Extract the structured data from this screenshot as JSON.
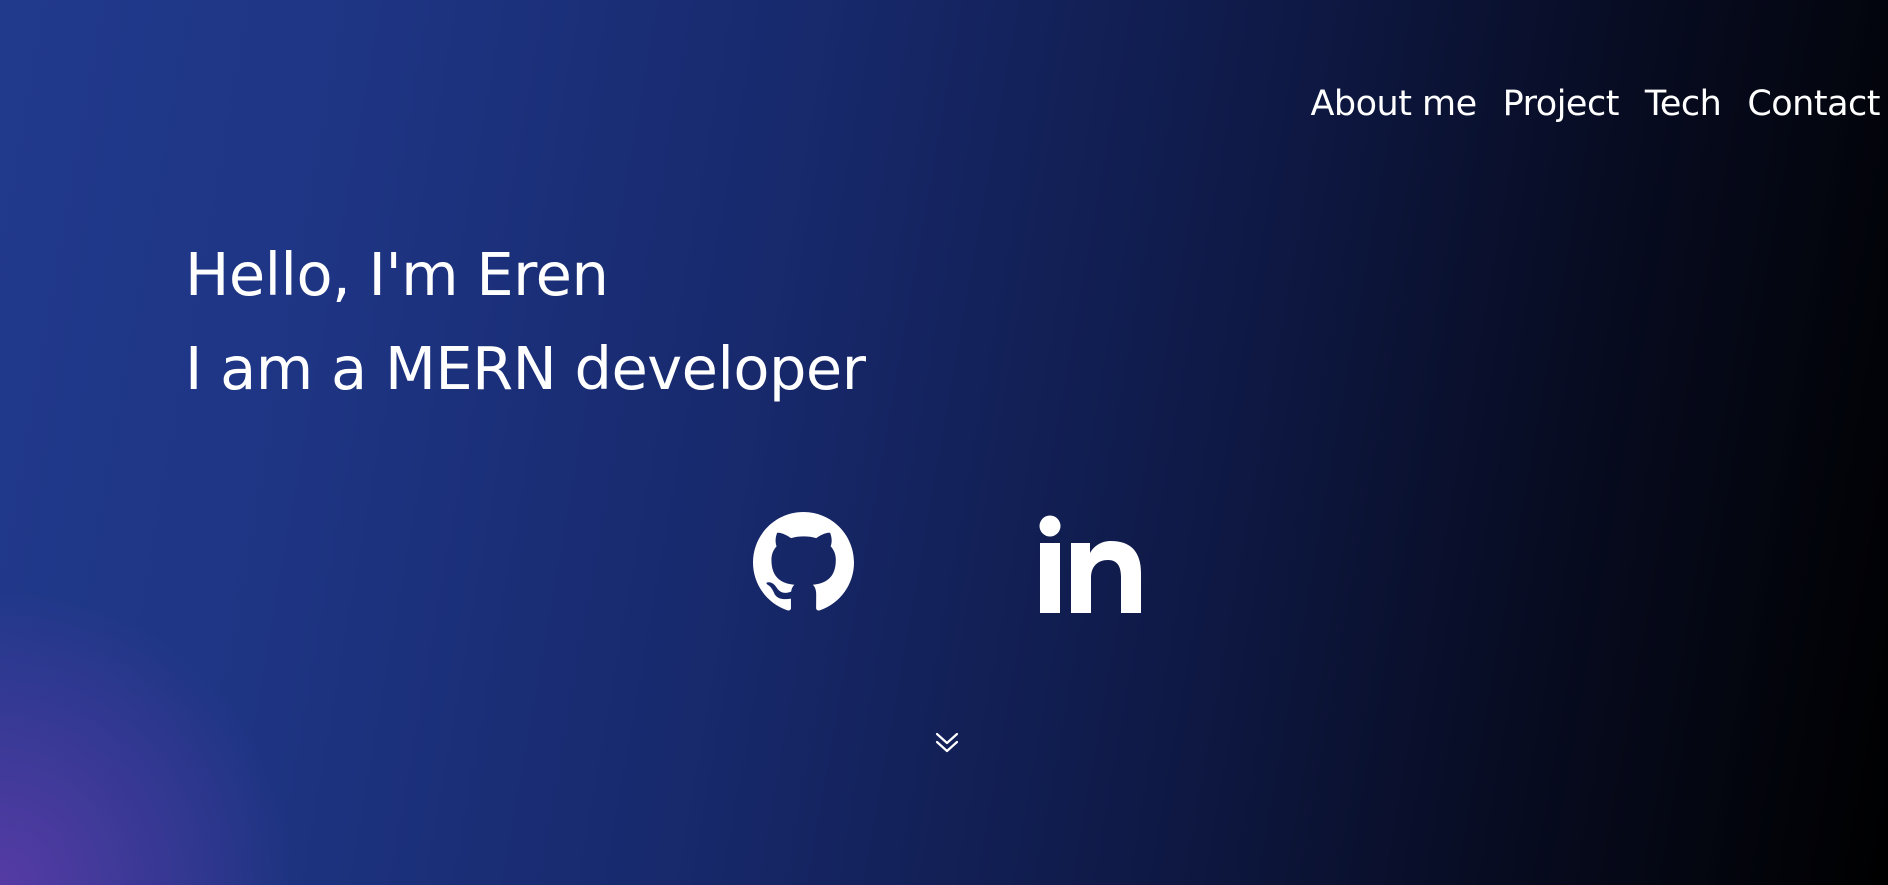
{
  "nav": {
    "items": [
      {
        "label": "About me"
      },
      {
        "label": "Project"
      },
      {
        "label": "Tech"
      },
      {
        "label": "Contact"
      }
    ]
  },
  "hero": {
    "greeting": "Hello, I'm Eren",
    "role": "I am a MERN developer"
  },
  "social": {
    "icons": [
      "github-icon",
      "linkedin-icon"
    ]
  },
  "scroll": {
    "icon": "double-chevron-down-icon"
  },
  "colors": {
    "background_start": "#223a8c",
    "background_end": "#000000",
    "accent_purple": "#5f3caa",
    "text": "#ffffff"
  }
}
